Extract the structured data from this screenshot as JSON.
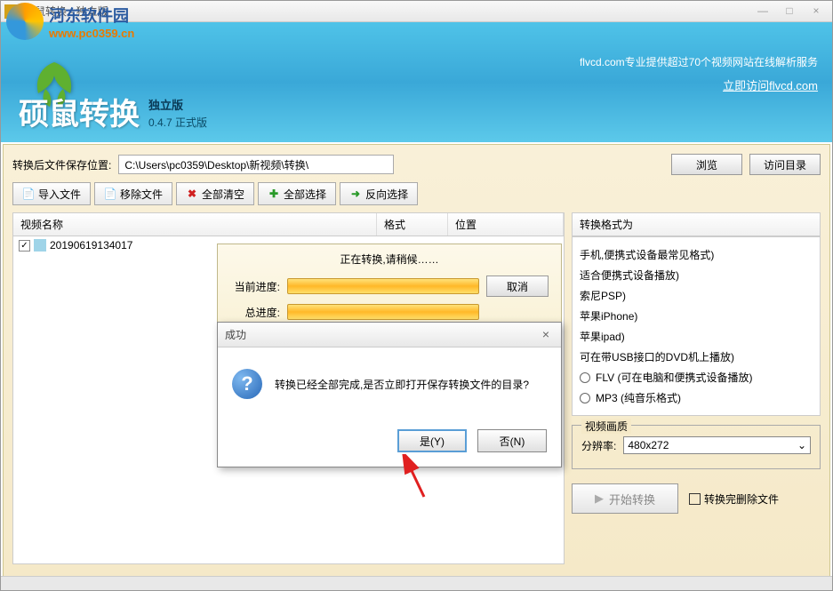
{
  "window": {
    "title": "硕鼠转换 - 独立版",
    "minimize": "—",
    "maximize": "□",
    "close": "×"
  },
  "watermark": {
    "name": "河东软件园",
    "url": "www.pc0359.cn"
  },
  "banner": {
    "promo": "flvcd.com专业提供超过70个视频网站在线解析服务",
    "promo_link": "立即访问flvcd.com",
    "title": "硕鼠转换",
    "edition": "独立版",
    "version": "0.4.7 正式版"
  },
  "path_row": {
    "label": "转换后文件保存位置:",
    "value": "C:\\Users\\pc0359\\Desktop\\新视频\\转换\\",
    "browse": "浏览",
    "visit": "访问目录"
  },
  "toolbar": {
    "import": "导入文件",
    "remove": "移除文件",
    "clear": "全部清空",
    "select_all": "全部选择",
    "invert": "反向选择"
  },
  "file_list": {
    "headers": {
      "name": "视频名称",
      "format": "格式",
      "location": "位置"
    },
    "items": [
      {
        "checked": true,
        "name": "20190619134017"
      }
    ]
  },
  "format_panel": {
    "header": "转换格式为",
    "options": [
      "手机,便携式设备最常见格式)",
      "适合便携式设备播放)",
      "索尼PSP)",
      "苹果iPhone)",
      "苹果ipad)",
      "可在带USB接口的DVD机上播放)",
      "FLV   (可在电脑和便携式设备播放)",
      "MP3  (纯音乐格式)"
    ]
  },
  "quality": {
    "legend": "视频画质",
    "label": "分辨率:",
    "value": "480x272"
  },
  "actions": {
    "start": "开始转换",
    "delete_after": "转换完删除文件"
  },
  "progress": {
    "title": "正在转换,请稍候……",
    "current_label": "当前进度:",
    "total_label": "总进度:",
    "cancel": "取消"
  },
  "dialog": {
    "title": "成功",
    "message": "转换已经全部完成,是否立即打开保存转换文件的目录?",
    "yes": "是(Y)",
    "no": "否(N)"
  }
}
